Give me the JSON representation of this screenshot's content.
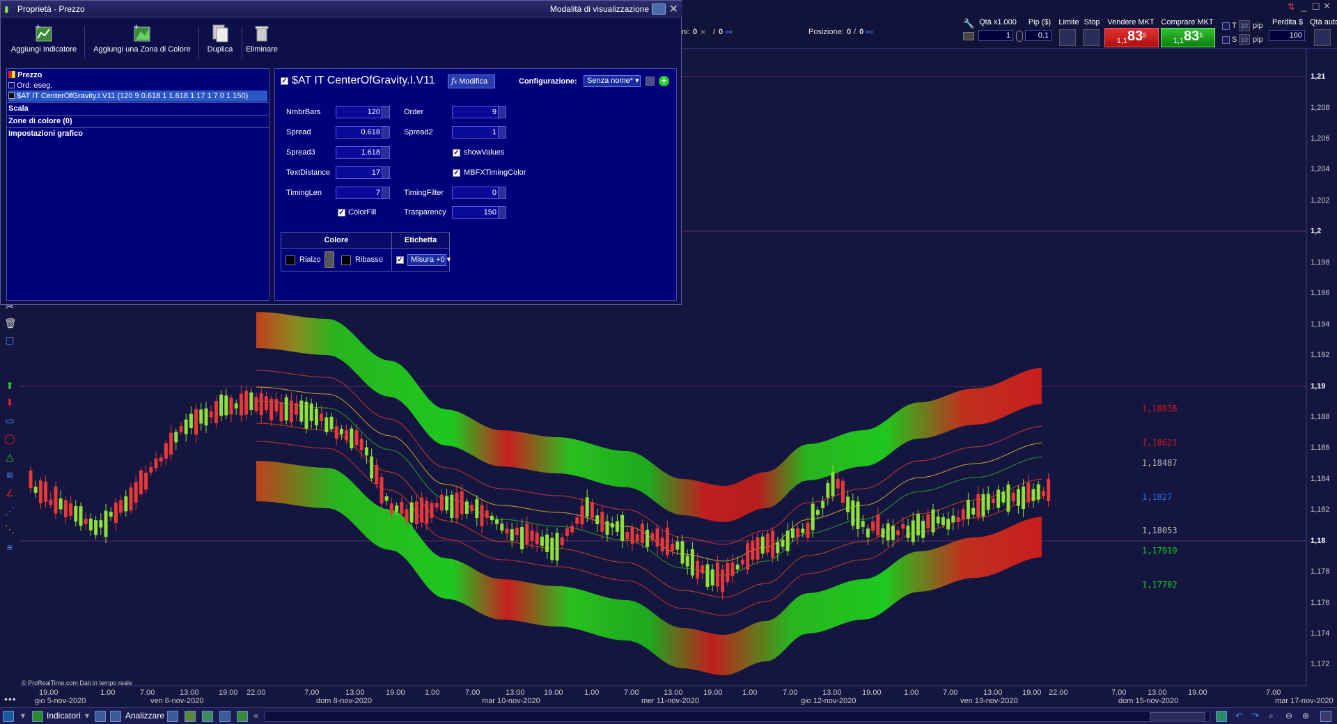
{
  "window": {
    "title": "Proprietà - Prezzo",
    "view_mode": "Modalità di visualizzazione"
  },
  "toolbar": {
    "add_indicator": "Aggiungi Indicatore",
    "add_color_zone": "Aggiungi una Zona di Colore",
    "duplicate": "Duplica",
    "delete": "Eliminare"
  },
  "tree": {
    "items": [
      {
        "label": "Prezzo"
      },
      {
        "label": "Ord. eseg."
      },
      {
        "label": "$AT IT CenterOfGravity.I.V11 (120 9 0.618 1 1.618 1 17 1 7 0 1 150)"
      },
      {
        "label": "Scala"
      },
      {
        "label": "Zone di colore (0)"
      },
      {
        "label": "Impostazioni grafico"
      }
    ]
  },
  "panel": {
    "indicator_name": "$AT IT CenterOfGravity.I.V11",
    "modify_label": "Modifica",
    "config_label": "Configurazione:",
    "config_value": "Senza nome*",
    "params": {
      "nmbrbars_label": "NmbrBars",
      "nmbrbars_value": "120",
      "order_label": "Order",
      "order_value": "9",
      "spread_label": "Spread",
      "spread_value": "0.618",
      "spread2_label": "Spread2",
      "spread2_value": "1",
      "spread3_label": "Spread3",
      "spread3_value": "1.618",
      "showvalues_label": "showValues",
      "textdistance_label": "TextDistance",
      "textdistance_value": "17",
      "mbfx_label": "MBFXTimingColor",
      "timinglen_label": "TimingLen",
      "timinglen_value": "7",
      "timingfilter_label": "TimingFilter",
      "timingfilter_value": "0",
      "colorfill_label": "ColorFill",
      "transparency_label": "Trasparency",
      "transparency_value": "150"
    },
    "table": {
      "color_header": "Colore",
      "label_header": "Etichetta",
      "rise_label": "Rialzo",
      "fall_label": "Ribasso",
      "measure_value": "Misura +0"
    }
  },
  "topbar": {
    "ni_label": "ni:",
    "ni_value": "0",
    "ni_value2": "0",
    "position_label": "Posizione:",
    "position_value": "0",
    "position_value2": "0",
    "qty_label": "Qtà x1.000",
    "qty_value": "1",
    "pip_label": "Pip ($)",
    "pip_value": "0.1",
    "limit_label": "Limite",
    "stop_label": "Stop",
    "sell_label": "Vendere MKT",
    "sell_prefix": "1,1",
    "sell_main": "83",
    "sell_sup": "5",
    "buy_label": "Comprare MKT",
    "buy_prefix": "1,1",
    "buy_main": "83",
    "buy_sup": "5",
    "t_label": "T",
    "t_value": "10",
    "t_unit": "pip",
    "s_label": "S",
    "s_value": "10",
    "s_unit": "pip",
    "loss_label": "Perdita $",
    "loss_value": "100",
    "auto_qty_label": "Qtà auto"
  },
  "price_axis": [
    "1,21",
    "1,208",
    "1,206",
    "1,204",
    "1,202",
    "1,2",
    "1,198",
    "1,196",
    "1,194",
    "1,192",
    "1,19",
    "1,188",
    "1,186",
    "1,184",
    "1,182",
    "1,18",
    "1,178",
    "1,176",
    "1,174",
    "1,172"
  ],
  "value_labels": [
    {
      "text": "1,18838",
      "color": "#d01a1a"
    },
    {
      "text": "1,18621",
      "color": "#d01a1a"
    },
    {
      "text": "1,18487",
      "color": "#bbbbbb"
    },
    {
      "text": "1,1827",
      "color": "#2a6ae0"
    },
    {
      "text": "1,18053",
      "color": "#bbbbbb"
    },
    {
      "text": "1,17919",
      "color": "#1acc1a"
    },
    {
      "text": "1,17702",
      "color": "#1acc1a"
    }
  ],
  "time_axis": {
    "times": [
      "19.00",
      "1.00",
      "7.00",
      "13.00",
      "19.00",
      "22.00",
      "7.00",
      "13.00",
      "19.00",
      "1.00",
      "7.00",
      "13.00",
      "19.00",
      "1.00",
      "7.00",
      "13.00",
      "19.00",
      "1.00",
      "7.00",
      "13.00",
      "19.00",
      "1.00",
      "7.00",
      "13.00",
      "19.00",
      "22.00",
      "7.00",
      "13.00",
      "19.00",
      "7.00"
    ],
    "dates": [
      "gio 5-nov-2020",
      "ven 6-nov-2020",
      "dom 8-nov-2020",
      "mar 10-nov-2020",
      "mer 11-nov-2020",
      "gio 12-nov-2020",
      "ven 13-nov-2020",
      "dom 15-nov-2020",
      "mar 17-nov-2020"
    ]
  },
  "copyright": "© ProRealTime.com  Dati in tempo reale",
  "bottombar": {
    "indicators": "Indicatori",
    "analyzer": "Analizzare"
  },
  "colors": {
    "background": "#141640",
    "bullish": "#8fe03a",
    "bearish": "#e83838",
    "band_green": "#1ec81e",
    "band_red": "#d01e1e"
  }
}
